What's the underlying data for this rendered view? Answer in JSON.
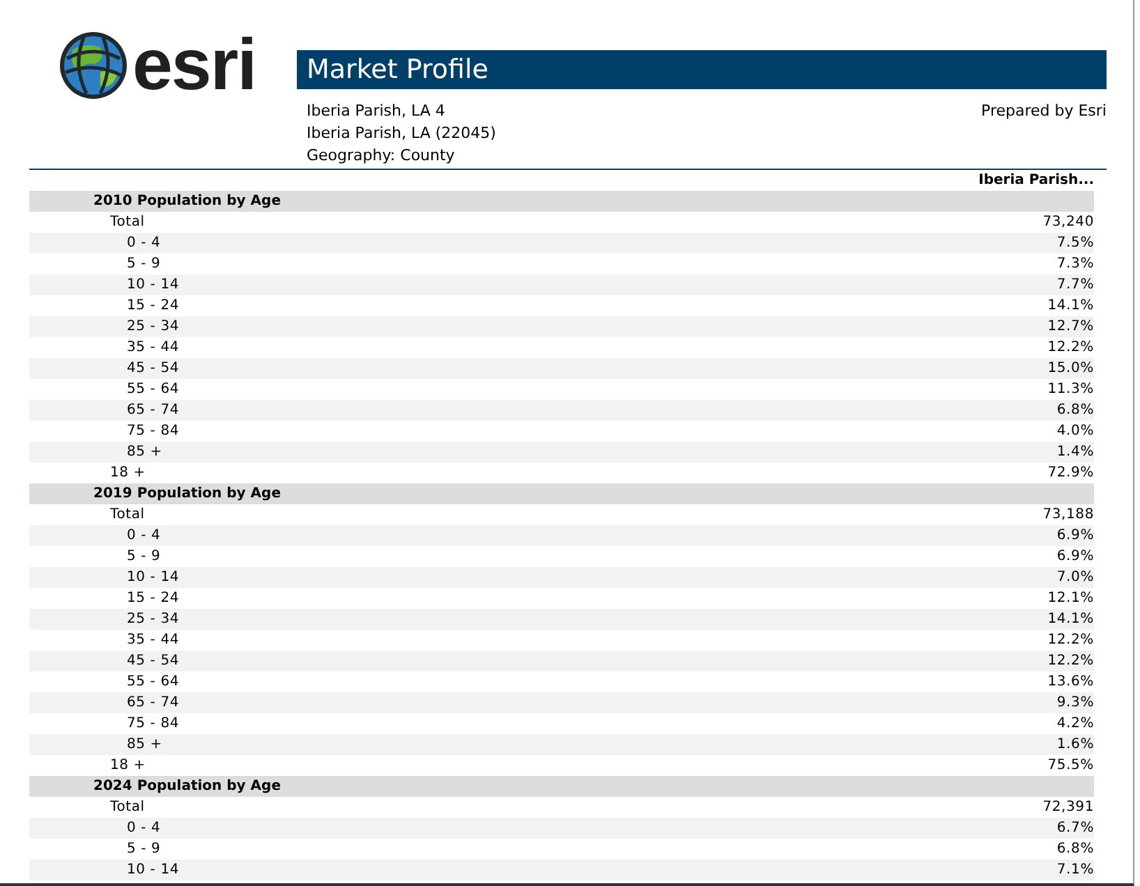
{
  "logo": {
    "text": "esri"
  },
  "title": "Market Profile",
  "location_lines": [
    "Iberia Parish, LA 4",
    "Iberia Parish, LA (22045)",
    "Geography: County"
  ],
  "prepared_by": "Prepared by Esri",
  "column_header": "Iberia Parish...",
  "sections": [
    {
      "title": "2010 Population by Age",
      "rows": [
        {
          "kind": "total",
          "label": "Total",
          "value": "73,240"
        },
        {
          "kind": "age",
          "label": "0 - 4",
          "value": "7.5%"
        },
        {
          "kind": "age",
          "label": "5 - 9",
          "value": "7.3%"
        },
        {
          "kind": "age",
          "label": "10 - 14",
          "value": "7.7%"
        },
        {
          "kind": "age",
          "label": "15 - 24",
          "value": "14.1%"
        },
        {
          "kind": "age",
          "label": "25 - 34",
          "value": "12.7%"
        },
        {
          "kind": "age",
          "label": "35 - 44",
          "value": "12.2%"
        },
        {
          "kind": "age",
          "label": "45 - 54",
          "value": "15.0%"
        },
        {
          "kind": "age",
          "label": "55 - 64",
          "value": "11.3%"
        },
        {
          "kind": "age",
          "label": "65 - 74",
          "value": "6.8%"
        },
        {
          "kind": "age",
          "label": "75 - 84",
          "value": "4.0%"
        },
        {
          "kind": "age",
          "label": "85 +",
          "value": "1.4%"
        },
        {
          "kind": "total",
          "label": "18 +",
          "value": "72.9%"
        }
      ]
    },
    {
      "title": "2019 Population by Age",
      "rows": [
        {
          "kind": "total",
          "label": "Total",
          "value": "73,188"
        },
        {
          "kind": "age",
          "label": "0 - 4",
          "value": "6.9%"
        },
        {
          "kind": "age",
          "label": "5 - 9",
          "value": "6.9%"
        },
        {
          "kind": "age",
          "label": "10 - 14",
          "value": "7.0%"
        },
        {
          "kind": "age",
          "label": "15 - 24",
          "value": "12.1%"
        },
        {
          "kind": "age",
          "label": "25 - 34",
          "value": "14.1%"
        },
        {
          "kind": "age",
          "label": "35 - 44",
          "value": "12.2%"
        },
        {
          "kind": "age",
          "label": "45 - 54",
          "value": "12.2%"
        },
        {
          "kind": "age",
          "label": "55 - 64",
          "value": "13.6%"
        },
        {
          "kind": "age",
          "label": "65 - 74",
          "value": "9.3%"
        },
        {
          "kind": "age",
          "label": "75 - 84",
          "value": "4.2%"
        },
        {
          "kind": "age",
          "label": "85 +",
          "value": "1.6%"
        },
        {
          "kind": "total",
          "label": "18 +",
          "value": "75.5%"
        }
      ]
    },
    {
      "title": "2024 Population by Age",
      "rows": [
        {
          "kind": "total",
          "label": "Total",
          "value": "72,391"
        },
        {
          "kind": "age",
          "label": "0 - 4",
          "value": "6.7%"
        },
        {
          "kind": "age",
          "label": "5 - 9",
          "value": "6.8%"
        },
        {
          "kind": "age",
          "label": "10 - 14",
          "value": "7.1%"
        }
      ]
    }
  ]
}
